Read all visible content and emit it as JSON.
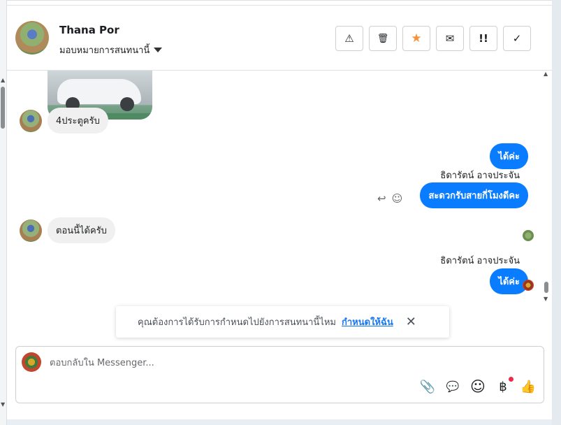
{
  "header": {
    "contact_name": "Thana Por",
    "assign_label": "มอบหมายการสนทนานี้",
    "actions": [
      {
        "name": "warning-icon",
        "glyph": "⚠"
      },
      {
        "name": "trash-icon",
        "glyph": "🗑"
      },
      {
        "name": "star-icon",
        "glyph": "★",
        "color": "#f7923b"
      },
      {
        "name": "mail-icon",
        "glyph": "✉"
      },
      {
        "name": "important-icon",
        "glyph": "!!"
      },
      {
        "name": "check-icon",
        "glyph": "✓"
      }
    ]
  },
  "messages": {
    "incoming_1": "4ประตูครับ",
    "outgoing_1": "ได้ค่ะ",
    "sender_1": "ธิดารัตน์ อาจประจัน",
    "outgoing_2": "สะดวกรับสายกี่โมงดีคะ",
    "incoming_2": "ตอนนี้ได้ครับ",
    "sender_2": "ธิดารัตน์ อาจประจัน",
    "outgoing_3": "ได้ค่ะ"
  },
  "notice": {
    "text": "คุณต้องการได้รับการกำหนดไปยังการสนทนานี้ไหม",
    "link": "กำหนดให้ฉัน",
    "close": "✕"
  },
  "composer": {
    "placeholder": "ตอบกลับใน Messenger...",
    "tools": [
      {
        "name": "attach-icon",
        "glyph": "📎"
      },
      {
        "name": "saved-reply-icon",
        "glyph": "💬"
      },
      {
        "name": "emoji-icon",
        "glyph": "☺"
      },
      {
        "name": "payment-icon",
        "glyph": "฿"
      },
      {
        "name": "like-icon",
        "glyph": "👍"
      }
    ]
  },
  "colors": {
    "outgoing_bubble": "#0a7cff",
    "incoming_bubble": "#f0f0f0",
    "link": "#1877f2",
    "star": "#f7923b"
  }
}
